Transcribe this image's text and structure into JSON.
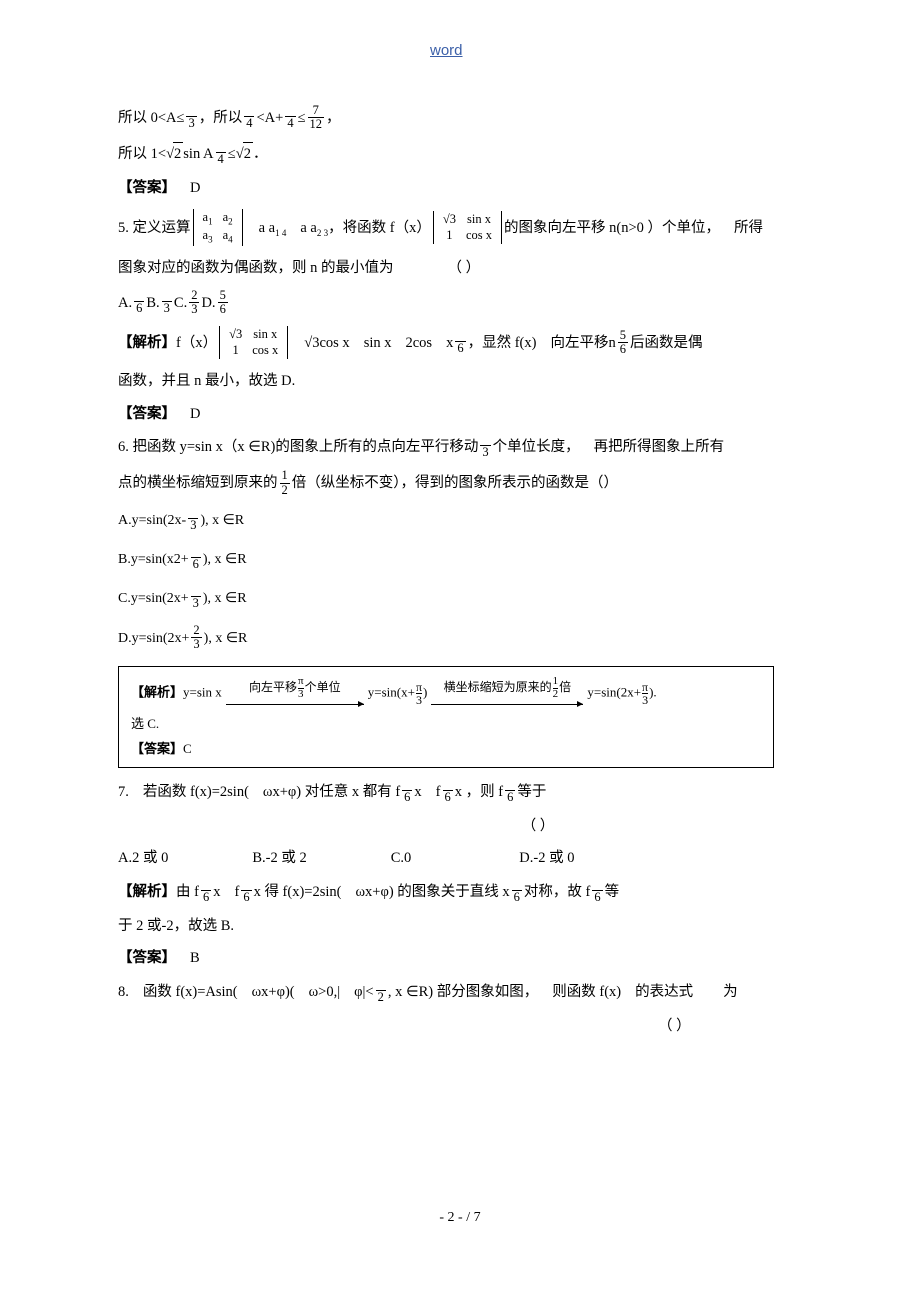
{
  "watermark": "word",
  "q4_tail": {
    "line1_a": "所以 0<A≤",
    "line1_frac": {
      "num": "",
      "den": "3"
    },
    "line1_b": "，所以",
    "line1_frac2": {
      "num": "",
      "den": "4"
    },
    "line1_c": "<A+",
    "line1_frac3": {
      "num": "",
      "den": "4"
    },
    "line1_d": "≤",
    "line1_frac4": {
      "num": "7",
      "den": "12"
    },
    "line1_e": "，",
    "line2_a": "所以 1<",
    "line2_sqrt": "2",
    "line2_b": "sin  A",
    "line2_frac": {
      "num": "",
      "den": "4"
    },
    "line2_c": "≤",
    "line2_sqrt2": "2",
    "line2_d": "．",
    "answer_label": "【答案】",
    "answer_value": "D"
  },
  "q5": {
    "number": "5.",
    "stem_a": "定义运算",
    "matrix1": [
      [
        "a",
        "a"
      ],
      [
        "a",
        "a"
      ]
    ],
    "matrix1_subs": [
      [
        "1",
        "2"
      ],
      [
        "3",
        "4"
      ]
    ],
    "stem_b": "a a",
    "stem_c": "a a",
    "stem_d": "，将函数 f（x）",
    "matrix2": [
      [
        "√3",
        "sin x"
      ],
      [
        "1",
        "cos x"
      ]
    ],
    "stem_e": "的图象向左平移 n(n>0 ）个单位，",
    "stem_f": "所得",
    "line2": "图象对应的函数为偶函数，则 n 的最小值为",
    "line2_paren": "（    ）",
    "choices": [
      {
        "label": "A.",
        "frac": {
          "num": "",
          "den": "6"
        }
      },
      {
        "label": "B.",
        "frac": {
          "num": "",
          "den": "3"
        }
      },
      {
        "label": "C.",
        "frac": {
          "num": "2",
          "den": "3"
        }
      },
      {
        "label": "D.",
        "frac": {
          "num": "5",
          "den": "6"
        }
      }
    ],
    "analysis_label": "【解析】",
    "analysis_a": "f（x）",
    "analysis_matrix": [
      [
        "√3",
        "sin x"
      ],
      [
        "1",
        "cos x"
      ]
    ],
    "analysis_b": "√3cos x",
    "analysis_c": "sin x",
    "analysis_d": "2cos",
    "analysis_e": "x",
    "analysis_frac": {
      "num": "",
      "den": "6"
    },
    "analysis_f": "，显然 f(x)",
    "analysis_g": "向左平移n",
    "analysis_frac2": {
      "num": "5",
      "den": "6"
    },
    "analysis_h": "后函数是偶",
    "analysis_line2": "函数，并且 n 最小，故选 D.",
    "answer_label": "【答案】",
    "answer_value": "D"
  },
  "q6": {
    "number": "6.",
    "stem_a": "把函数 y=sin  x（x ∈R)的图象上所有的点向左平行移动",
    "stem_blank": "",
    "stem_frac": {
      "num": "",
      "den": "3"
    },
    "stem_b": "个单位长度，",
    "stem_c": "再把所得图象上所有",
    "line2_a": "点的横坐标缩短到原来的",
    "line2_frac": {
      "num": "1",
      "den": "2"
    },
    "line2_b": "倍（纵坐标不变），得到的图象所表示的函数是（）",
    "choices": [
      {
        "label": "A.",
        "pre": "y=sin(2x-",
        "frac": {
          "num": "",
          "den": "3"
        },
        "post": "), x  ∈R"
      },
      {
        "label": "B.",
        "pre": "y=sin(x2+",
        "frac": {
          "num": "",
          "den": "6"
        },
        "post": "), x  ∈R"
      },
      {
        "label": "C.",
        "pre": "y=sin(2x+",
        "frac": {
          "num": "",
          "den": "3"
        },
        "post": "), x  ∈R"
      },
      {
        "label": "D.",
        "pre": "y=sin(2x+",
        "frac": {
          "num": "2",
          "den": "3"
        },
        "post": "), x  ∈R"
      }
    ],
    "box": {
      "analysis_label": "【解析】",
      "expr1": "y=sin x",
      "arrow1_label_a": "向左平移",
      "arrow1_label_frac": {
        "num": "π",
        "den": "3"
      },
      "arrow1_label_b": "个单位",
      "expr2_a": "y=sin(x+",
      "expr2_frac": {
        "num": "π",
        "den": "3"
      },
      "expr2_b": ")",
      "arrow2_label_a": "横坐标缩短为原来的",
      "arrow2_label_frac": {
        "num": "1",
        "den": "2"
      },
      "arrow2_label_b": "倍",
      "expr3_a": "y=sin(2x+",
      "expr3_frac": {
        "num": "π",
        "den": "3"
      },
      "expr3_b": ").",
      "choose": "选 C.",
      "answer_label": "【答案】",
      "answer_value": "C"
    }
  },
  "q7": {
    "number": "7.",
    "stem_a": "若函数 f(x)=2sin(",
    "stem_b": "ωx+φ) 对任意 x 都有 f",
    "frac1": {
      "num": "",
      "den": "6"
    },
    "stem_c": "x",
    "stem_d": "f",
    "frac2": {
      "num": "",
      "den": "6"
    },
    "stem_e": "x ，则 f",
    "frac3": {
      "num": "",
      "den": "6"
    },
    "stem_f": "等于",
    "paren": "（    ）",
    "choices": [
      "A.2 或 0",
      "B.-2 或 2",
      "C.0",
      "D.-2 或 0"
    ],
    "analysis_label": "【解析】",
    "analysis_a": "由 f",
    "analysis_frac1": {
      "num": "",
      "den": "6"
    },
    "analysis_b": "x",
    "analysis_c": "f",
    "analysis_frac2": {
      "num": "",
      "den": "6"
    },
    "analysis_d": "x 得 f(x)=2sin(",
    "analysis_e": "ωx+φ) 的图象关于直线 x",
    "analysis_frac3": {
      "num": "",
      "den": "6"
    },
    "analysis_f": "对称，故 f",
    "analysis_frac4": {
      "num": "",
      "den": "6"
    },
    "analysis_g": "等",
    "analysis_line2": "于 2 或-2，故选 B.",
    "answer_label": "【答案】",
    "answer_value": "B"
  },
  "q8": {
    "number": "8.",
    "stem_a": "函数 f(x)=Asin(",
    "stem_b": "ωx+φ)(",
    "stem_c": "ω>0,|",
    "stem_d": "φ|<",
    "frac": {
      "num": "",
      "den": "2"
    },
    "stem_e": ", x ∈R) 部分图象如图，",
    "stem_f": "则函数 f(x)",
    "stem_g": "的表达式",
    "stem_h": "为",
    "paren": "（    ）"
  },
  "footer": "- 2 - / 7"
}
